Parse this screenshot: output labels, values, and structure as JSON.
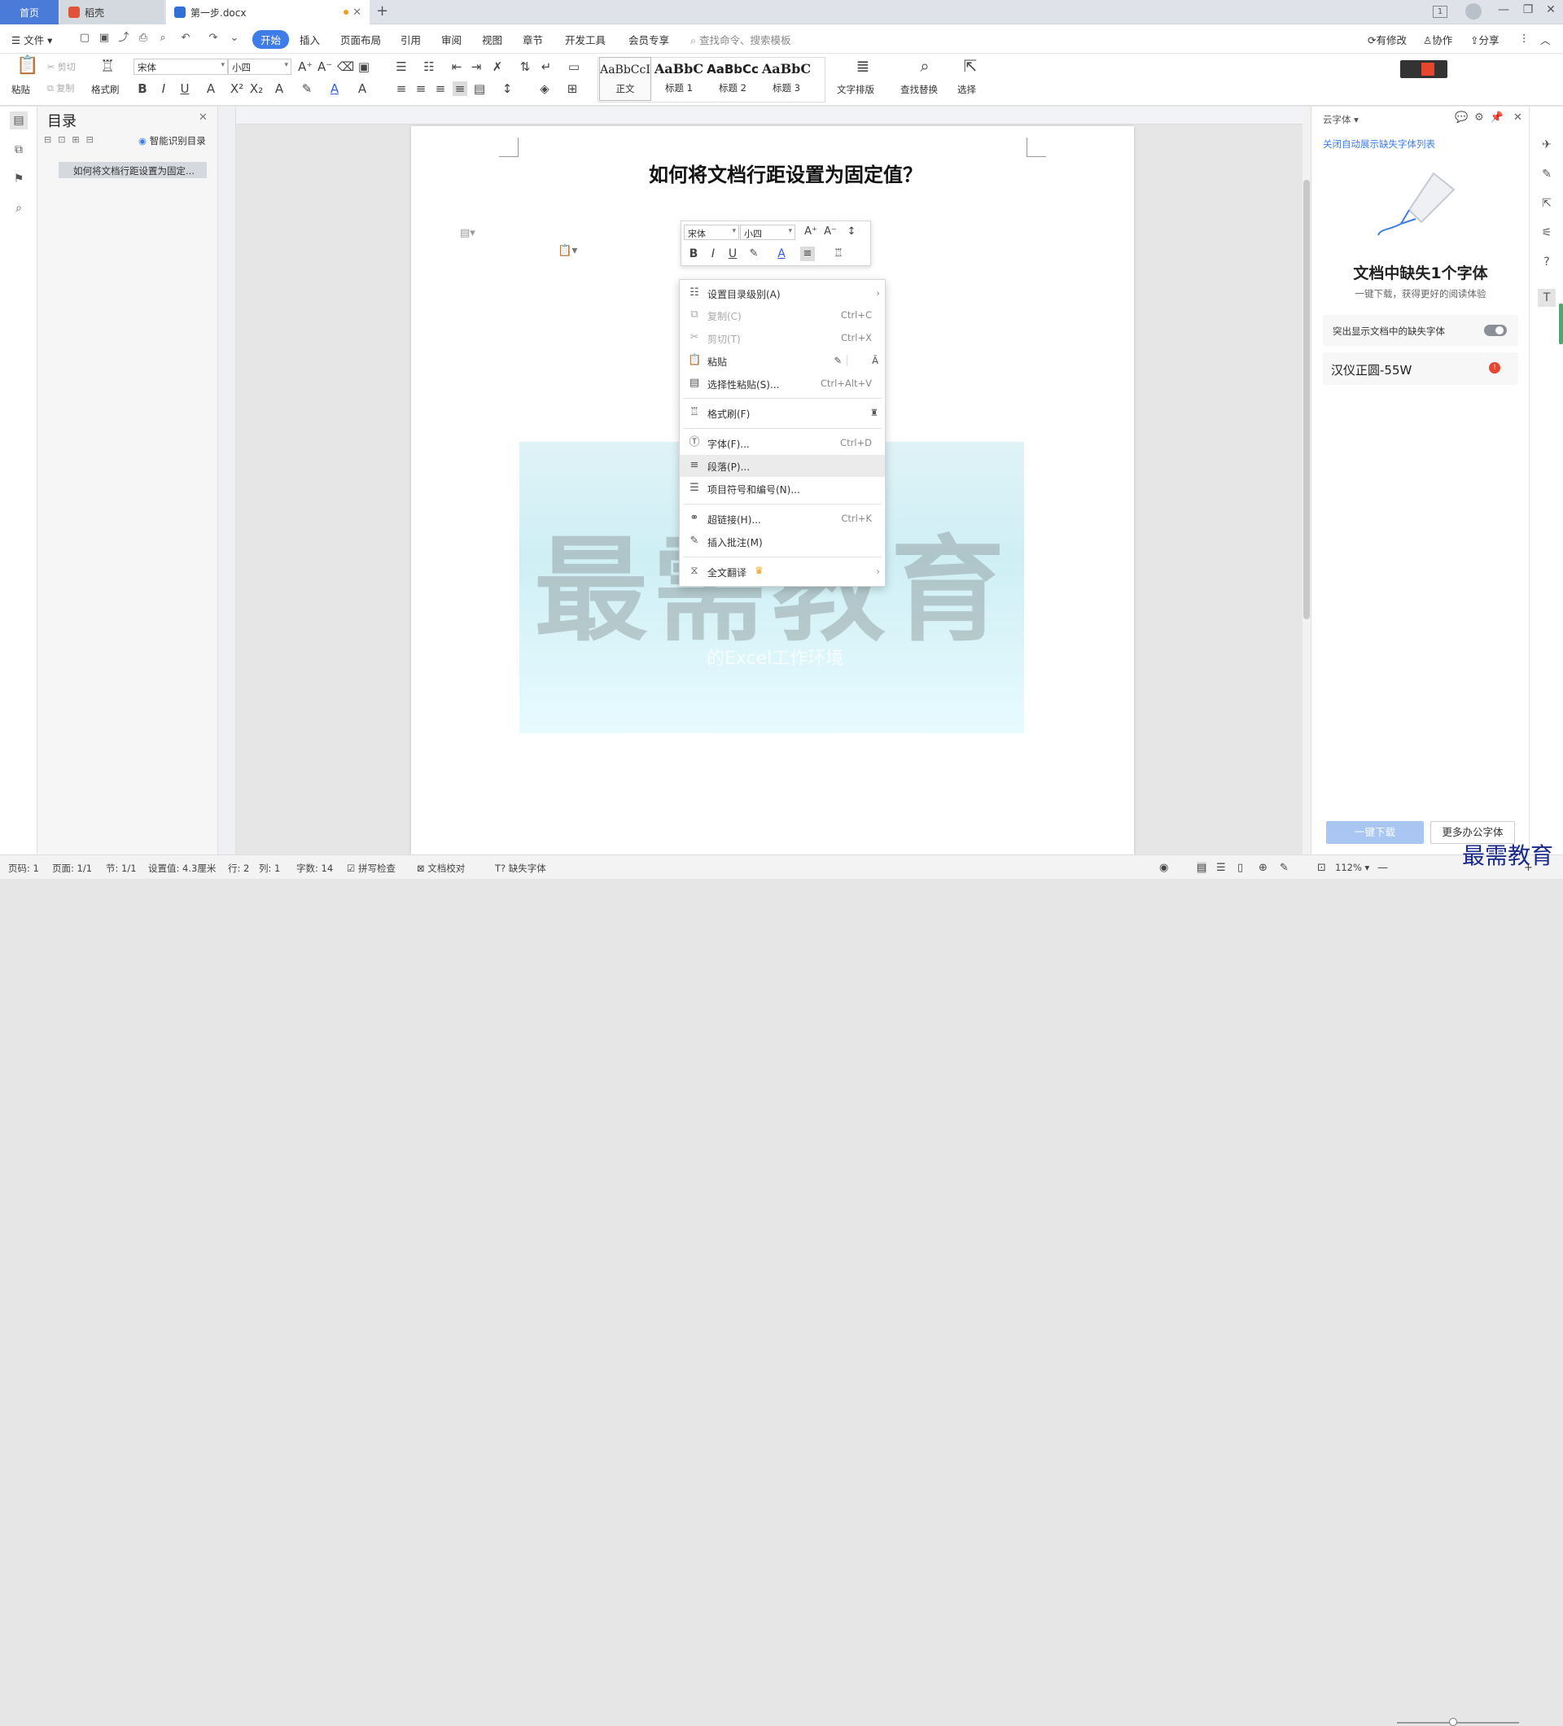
{
  "titlebar": {
    "tabs": [
      {
        "label": "首页"
      },
      {
        "label": "稻壳"
      },
      {
        "label": "第一步.docx"
      }
    ],
    "new_tab": "+",
    "page_indicator": "1"
  },
  "menubar": {
    "file": "文件",
    "tabs": [
      "开始",
      "插入",
      "页面布局",
      "引用",
      "审阅",
      "视图",
      "章节",
      "开发工具",
      "会员专享"
    ],
    "search": "查找命令、搜索模板",
    "right": [
      "有修改",
      "协作",
      "分享"
    ]
  },
  "ribbon": {
    "paste": "粘贴",
    "cut": "剪切",
    "copy": "复制",
    "format_painter": "格式刷",
    "font_name": "宋体",
    "font_size": "小四",
    "styles": [
      {
        "sample": "AaBbCcI",
        "label": "正文"
      },
      {
        "sample": "AaBbC",
        "label": "标题 1"
      },
      {
        "sample": "AaBbCc",
        "label": "标题 2"
      },
      {
        "sample": "AaBbC",
        "label": "标题 3"
      }
    ],
    "text_layout": "文字排版",
    "find_replace": "查找替换",
    "select": "选择"
  },
  "toc_pane": {
    "title": "目录",
    "smart": "智能识别目录",
    "item": "如何将文档行距设置为固定..."
  },
  "document": {
    "title": "如何将文档行距设置为固定值？",
    "watermark": "最需教育",
    "image_caption": "的Excel工作环境"
  },
  "mini_toolbar": {
    "font_name": "宋体",
    "font_size": "小四"
  },
  "context_menu": {
    "items": [
      {
        "label": "设置目录级别(A)",
        "shortcut": "",
        "disabled": false,
        "sub": true
      },
      {
        "label": "复制(C)",
        "shortcut": "Ctrl+C",
        "disabled": true
      },
      {
        "label": "剪切(T)",
        "shortcut": "Ctrl+X",
        "disabled": true
      },
      {
        "label": "粘贴",
        "shortcut": "",
        "disabled": false
      },
      {
        "label": "选择性粘贴(S)...",
        "shortcut": "Ctrl+Alt+V",
        "disabled": false
      },
      {
        "label": "格式刷(F)",
        "shortcut": "",
        "disabled": false
      },
      {
        "label": "字体(F)...",
        "shortcut": "Ctrl+D",
        "disabled": false
      },
      {
        "label": "段落(P)...",
        "shortcut": "",
        "disabled": false,
        "highlight": true
      },
      {
        "label": "项目符号和编号(N)...",
        "shortcut": "",
        "disabled": false
      },
      {
        "label": "超链接(H)...",
        "shortcut": "Ctrl+K",
        "disabled": false
      },
      {
        "label": "插入批注(M)",
        "shortcut": "",
        "disabled": false
      },
      {
        "label": "全文翻译",
        "shortcut": "",
        "disabled": false,
        "sub": true
      }
    ]
  },
  "right_panel": {
    "header": "云字体",
    "link": "关闭自动展示缺失字体列表",
    "heading": "文档中缺失1个字体",
    "sub": "一键下载，获得更好的阅读体验",
    "toggle_label": "突出显示文档中的缺失字体",
    "font_item": "汉仪正圆-55W",
    "download_btn": "一键下载",
    "more_btn": "更多办公字体"
  },
  "statusbar": {
    "page_code": "页码: 1",
    "pages": "页面: 1/1",
    "section": "节: 1/1",
    "setting": "设置值: 4.3厘米",
    "row": "行: 2",
    "col": "列: 1",
    "words": "字数: 14",
    "spell": "拼写检查",
    "proof": "文档校对",
    "missing_font": "缺失字体",
    "zoom": "112%"
  },
  "brand_watermark": "最需教育",
  "colors": {
    "accent": "#3e7ce8",
    "highlight": "#ebebeb"
  }
}
